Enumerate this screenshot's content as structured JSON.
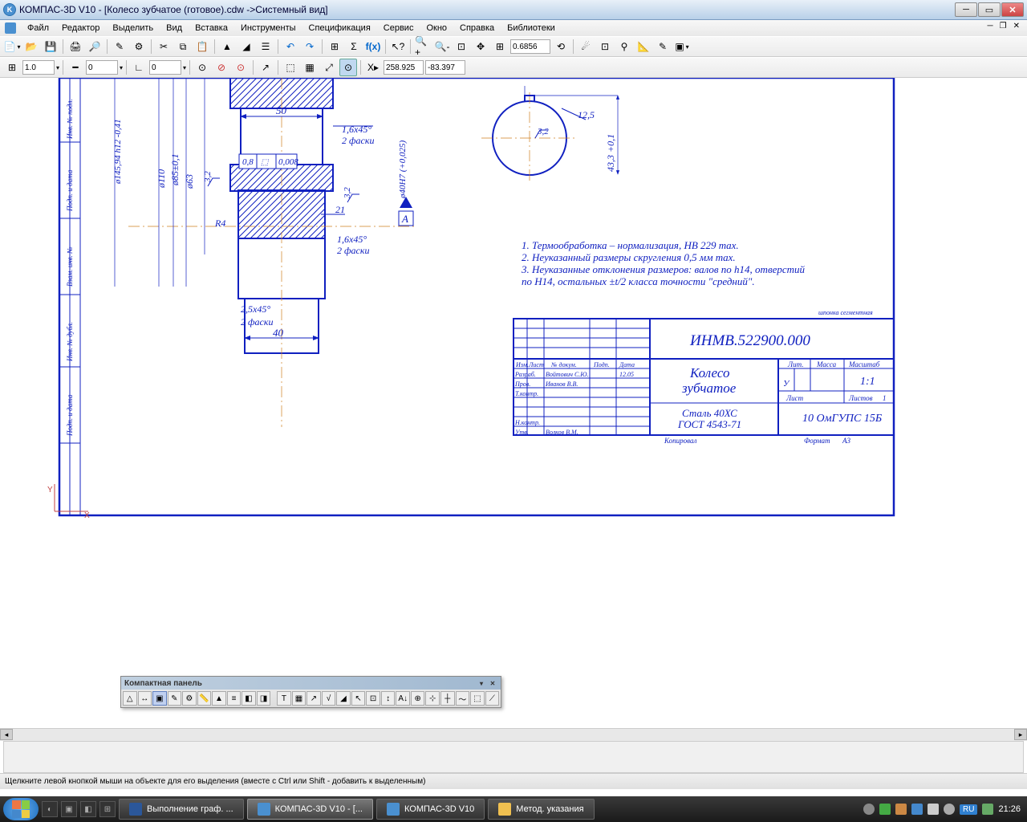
{
  "titlebar": {
    "title": "КОМПАС-3D V10 - [Колесо зубчатое (готовое).cdw ->Системный вид]"
  },
  "menubar": {
    "items": [
      "Файл",
      "Редактор",
      "Выделить",
      "Вид",
      "Вставка",
      "Инструменты",
      "Спецификация",
      "Сервис",
      "Окно",
      "Справка",
      "Библиотеки"
    ]
  },
  "toolbar1": {
    "zoom_value": "0.6856"
  },
  "toolbar2": {
    "step_value": "1.0",
    "style_value": "0",
    "angle_value": "0",
    "coord_x": "258.925",
    "coord_y": "-83.397"
  },
  "compact_panel": {
    "title": "Компактная панель"
  },
  "drawing": {
    "dims": {
      "d50": "50",
      "d40": "40",
      "d21": "21",
      "r4": "R4",
      "chamfer16": "1,6x45°",
      "faski2": "2 фаски",
      "chamfer25": "2,5x45°",
      "d08": "0,8",
      "tol0008": "0,008",
      "ra32": "3,2",
      "phi110": "ø110",
      "phi63": "ø63",
      "phi85": "ø85±0,1",
      "phi145": "ø145,94 h12 -0,41",
      "phi40": "ø40Н7 (+0,025)",
      "section_a": "А",
      "d125": "12,5",
      "d433": "43,3 +0,1",
      "ra32b": "3,2"
    },
    "notes": {
      "n1": "1. Термообработка – нормализация, НВ 229 max.",
      "n2": "2. Неуказанный размеры скругления 0,5 мм max.",
      "n3a": "3. Неуказанные отклонения размеров: валов по h14, отверстий",
      "n3b": "   по Н14, остальных ±t/2 класса точности \"средний\".",
      "small": "шпонка сегментная"
    },
    "titleblock": {
      "code": "ИНМВ.522900.000",
      "name1": "Колесо",
      "name2": "зубчатое",
      "material1": "Сталь 40ХС",
      "material2": "ГОСТ 4543-71",
      "scale_label": "Масштаб",
      "scale": "1:1",
      "mass_label": "Масса",
      "lit_label": "Лит.",
      "list_label": "Лист",
      "listov_label": "Листов",
      "listov_val": "1",
      "org": "10 ОмГУПС 15Б",
      "dev": "Разраб.",
      "dev_name": "Войтович С.Ю.",
      "prov": "Пров.",
      "prov_name": "Иванов В.В.",
      "tkontr": "Т.контр.",
      "nkontr": "Н.контр.",
      "utv": "Утв.",
      "utv_name": "Волков В.М.",
      "date": "12.05",
      "izm": "Изм.",
      "list": "Лист",
      "ndokum": "№ докум.",
      "podp": "Подп.",
      "data": "Дата",
      "kopiroval": "Копировал",
      "format": "Формат",
      "format_val": "А3",
      "u": "У"
    },
    "sidecol": {
      "c1": "Подп. и дата",
      "c2": "Инв. № дубл.",
      "c3": "Взам. инв. №",
      "c4": "Подп. и дата",
      "c5": "Инв. № подл."
    }
  },
  "statusbar": {
    "text": "Щелкните левой кнопкой мыши на объекте для его выделения (вместе с Ctrl или Shift - добавить к выделенным)"
  },
  "taskbar": {
    "items": [
      {
        "label": "Выполнение граф. ..."
      },
      {
        "label": "КОМПАС-3D V10 - [..."
      },
      {
        "label": "КОМПАС-3D V10"
      },
      {
        "label": "Метод. указания"
      }
    ],
    "lang": "RU",
    "time": "21:26"
  }
}
